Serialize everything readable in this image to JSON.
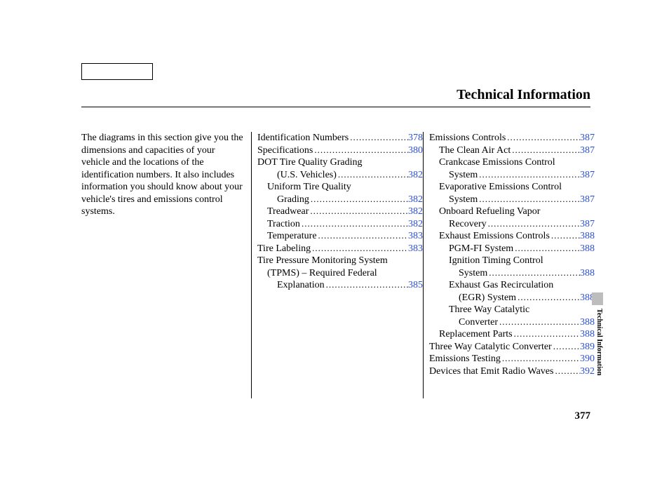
{
  "pageTitle": "Technical Information",
  "intro": "The diagrams in this section give you the dimensions and capacities of your vehicle and the locations of the identification numbers. It also includes information you should know about your vehicle's tires and emissions control systems.",
  "col1": [
    {
      "label": "Identification Numbers",
      "page": "378",
      "indent": 0,
      "link": true
    },
    {
      "label": "Specifications",
      "page": "380",
      "indent": 0,
      "link": true
    },
    {
      "label": "DOT Tire Quality Grading",
      "indent": 0,
      "link": false
    },
    {
      "label": "(U.S. Vehicles)",
      "page": "382",
      "indent": 2,
      "link": true
    },
    {
      "label": "Uniform Tire Quality",
      "indent": 1,
      "link": false
    },
    {
      "label": "Grading",
      "page": "382",
      "indent": 2,
      "link": true
    },
    {
      "label": "Treadwear",
      "page": "382",
      "indent": 1,
      "link": true
    },
    {
      "label": "Traction",
      "page": "382",
      "indent": 1,
      "link": true
    },
    {
      "label": "Temperature",
      "page": "383",
      "indent": 1,
      "link": true
    },
    {
      "label": "Tire Labeling",
      "page": "383",
      "indent": 0,
      "link": true
    },
    {
      "label": "Tire Pressure Monitoring System",
      "indent": 0,
      "link": false
    },
    {
      "label": "(TPMS) – Required Federal",
      "indent": 1,
      "link": false
    },
    {
      "label": "Explanation",
      "page": "385",
      "indent": 2,
      "link": true
    }
  ],
  "col2": [
    {
      "label": "Emissions Controls",
      "page": "387",
      "indent": 0,
      "link": true
    },
    {
      "label": "The Clean Air Act",
      "page": "387",
      "indent": 1,
      "link": true
    },
    {
      "label": "Crankcase Emissions Control",
      "indent": 1,
      "link": false
    },
    {
      "label": "System",
      "page": "387",
      "indent": 2,
      "link": true
    },
    {
      "label": "Evaporative Emissions Control",
      "indent": 1,
      "link": false
    },
    {
      "label": "System",
      "page": "387",
      "indent": 2,
      "link": true
    },
    {
      "label": "Onboard Refueling Vapor",
      "indent": 1,
      "link": false
    },
    {
      "label": "Recovery",
      "page": "387",
      "indent": 2,
      "link": true
    },
    {
      "label": "Exhaust Emissions Controls",
      "page": "388",
      "indent": 1,
      "link": true
    },
    {
      "label": "PGM-FI System",
      "page": "388",
      "indent": 2,
      "link": true
    },
    {
      "label": "Ignition Timing Control",
      "indent": 2,
      "link": false
    },
    {
      "label": "System",
      "page": "388",
      "indent": 3,
      "link": true
    },
    {
      "label": "Exhaust Gas Recirculation",
      "indent": 2,
      "link": false
    },
    {
      "label": "(EGR) System",
      "page": "388",
      "indent": 3,
      "link": true
    },
    {
      "label": "Three Way Catalytic",
      "indent": 2,
      "link": false
    },
    {
      "label": "Converter",
      "page": "388",
      "indent": 3,
      "link": true
    },
    {
      "label": "Replacement Parts",
      "page": "388",
      "indent": 1,
      "link": true
    },
    {
      "label": "Three Way Catalytic Converter",
      "page": "389",
      "indent": 0,
      "link": true
    },
    {
      "label": "Emissions Testing",
      "page": "390",
      "indent": 0,
      "link": true
    },
    {
      "label": "Devices that Emit Radio Waves",
      "page": "392",
      "indent": 0,
      "link": true
    }
  ],
  "sideLabel": "Technical Information",
  "pageNumber": "377"
}
